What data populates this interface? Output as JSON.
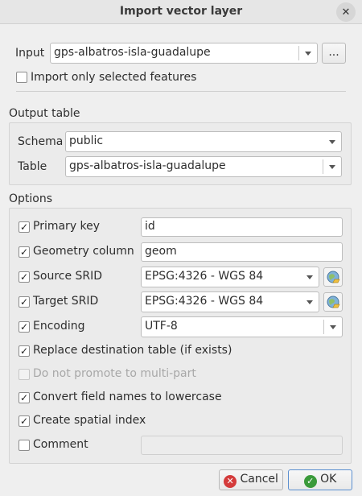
{
  "window": {
    "title": "Import vector layer",
    "close_symbol": "✕"
  },
  "input": {
    "label": "Input",
    "value": "gps-albatros-isla-guadalupe",
    "browse_label": "...",
    "import_selected_label": "Import only selected features",
    "import_selected_checked": false
  },
  "output_table": {
    "heading": "Output table",
    "schema_label": "Schema",
    "schema_value": "public",
    "table_label": "Table",
    "table_value": "gps-albatros-isla-guadalupe"
  },
  "options": {
    "heading": "Options",
    "primary_key": {
      "label": "Primary key",
      "checked": true,
      "value": "id"
    },
    "geometry_column": {
      "label": "Geometry column",
      "checked": true,
      "value": "geom"
    },
    "source_srid": {
      "label": "Source SRID",
      "checked": true,
      "value": "EPSG:4326 - WGS 84"
    },
    "target_srid": {
      "label": "Target SRID",
      "checked": true,
      "value": "EPSG:4326 - WGS 84"
    },
    "encoding": {
      "label": "Encoding",
      "checked": true,
      "value": "UTF-8"
    },
    "replace_table": {
      "label": "Replace destination table (if exists)",
      "checked": true
    },
    "no_promote": {
      "label": "Do not promote to multi-part",
      "checked": false,
      "enabled": false
    },
    "lowercase": {
      "label": "Convert field names to lowercase",
      "checked": true
    },
    "spatial_index": {
      "label": "Create spatial index",
      "checked": true
    },
    "comment": {
      "label": "Comment",
      "checked": false,
      "value": ""
    }
  },
  "buttons": {
    "cancel_label": "Cancel",
    "ok_label": "OK",
    "cancel_color": "#d43b3b",
    "ok_color": "#3a9a3a"
  },
  "check_mark": "✓"
}
